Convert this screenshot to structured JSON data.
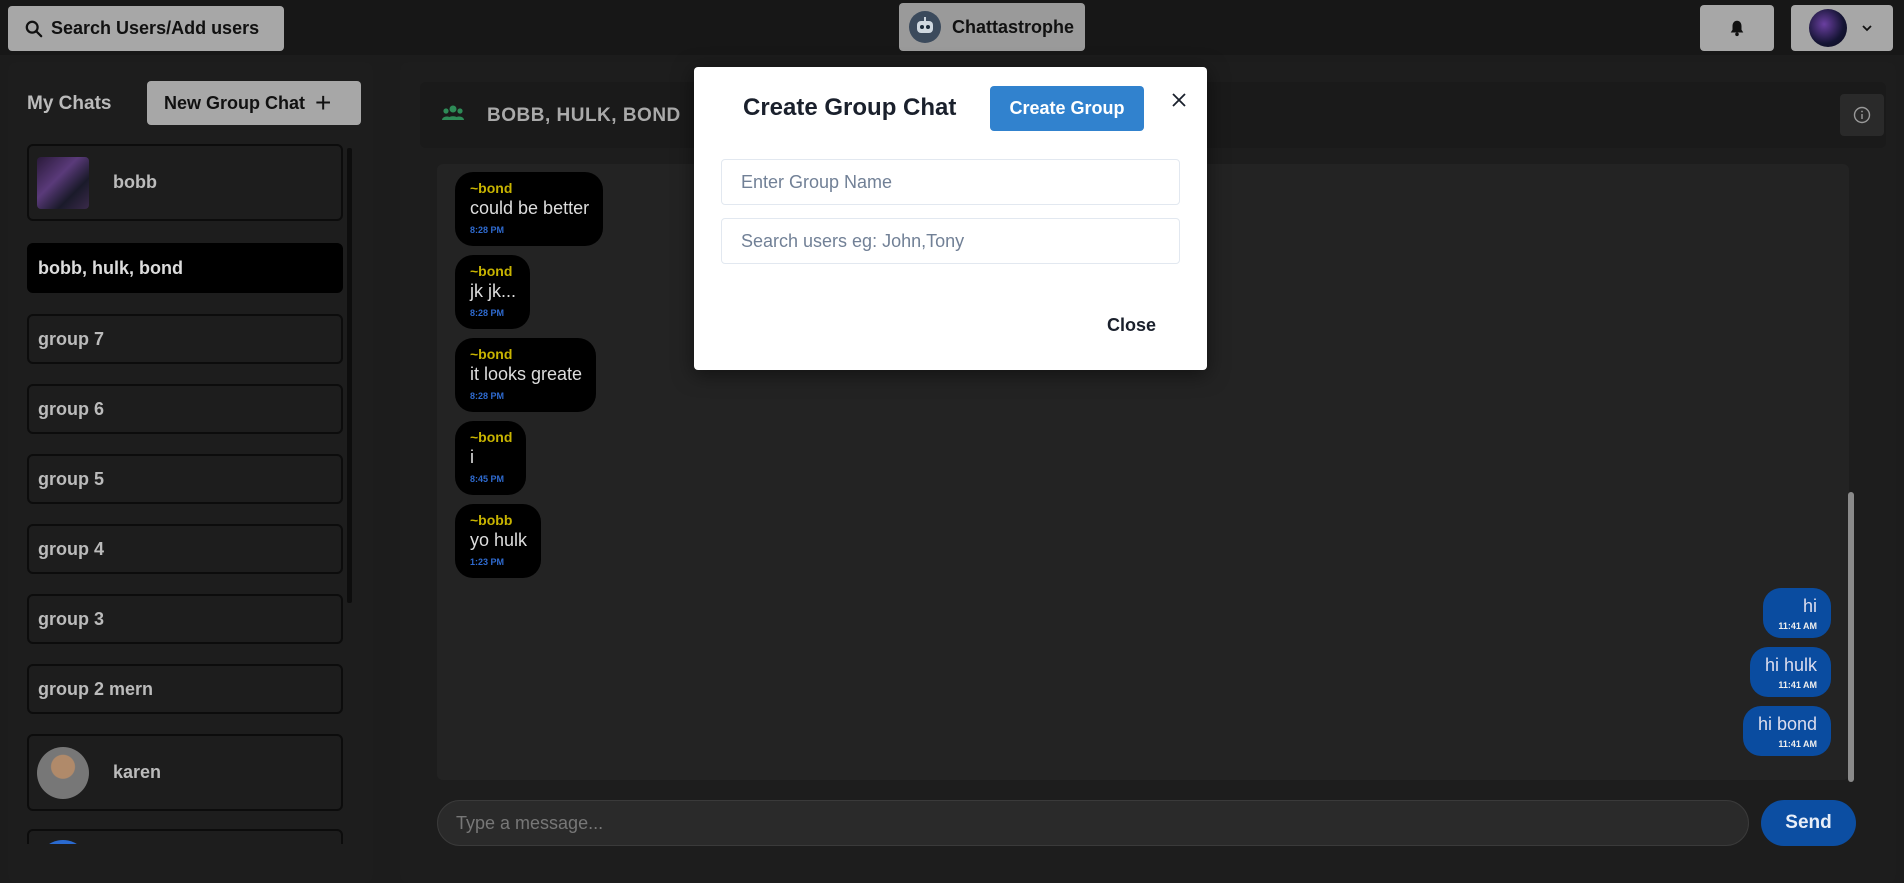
{
  "topbar": {
    "search_label": "Search Users/Add users",
    "app_name": "Chattastrophe"
  },
  "sidebar": {
    "header": "My Chats",
    "new_group_label": "New Group Chat",
    "chats": [
      {
        "label": "bobb"
      },
      {
        "label": "bobb, hulk, bond"
      },
      {
        "label": "group 7"
      },
      {
        "label": "group 6"
      },
      {
        "label": "group 5"
      },
      {
        "label": "group 4"
      },
      {
        "label": "group 3"
      },
      {
        "label": "group 2 mern"
      },
      {
        "label": "karen"
      }
    ]
  },
  "chat": {
    "title": "BOBB, HULK, BOND",
    "messages": [
      {
        "sender": "~bond",
        "text": "could be better",
        "time": "8:28 PM",
        "direction": "in"
      },
      {
        "sender": "~bond",
        "text": "jk jk...",
        "time": "8:28 PM",
        "direction": "in"
      },
      {
        "sender": "~bond",
        "text": "it looks greate",
        "time": "8:28 PM",
        "direction": "in"
      },
      {
        "sender": "~bond",
        "text": "i",
        "time": "8:45 PM",
        "direction": "in"
      },
      {
        "sender": "~bobb",
        "text": "yo hulk",
        "time": "1:23 PM",
        "direction": "in"
      },
      {
        "text": "hi",
        "time": "11:41 AM",
        "direction": "out"
      },
      {
        "text": "hi hulk",
        "time": "11:41 AM",
        "direction": "out"
      },
      {
        "text": "hi bond",
        "time": "11:41 AM",
        "direction": "out"
      }
    ],
    "input_placeholder": "Type a message...",
    "send_label": "Send"
  },
  "modal": {
    "title": "Create Group Chat",
    "create_label": "Create Group",
    "name_placeholder": "Enter Group Name",
    "search_placeholder": "Search users eg: John,Tony",
    "close_label": "Close"
  },
  "colors": {
    "background": "#1c1c1c",
    "accent_blue": "#3182ce",
    "outgoing_bubble": "#0a4ca0",
    "sender_name": "#c8b400"
  }
}
